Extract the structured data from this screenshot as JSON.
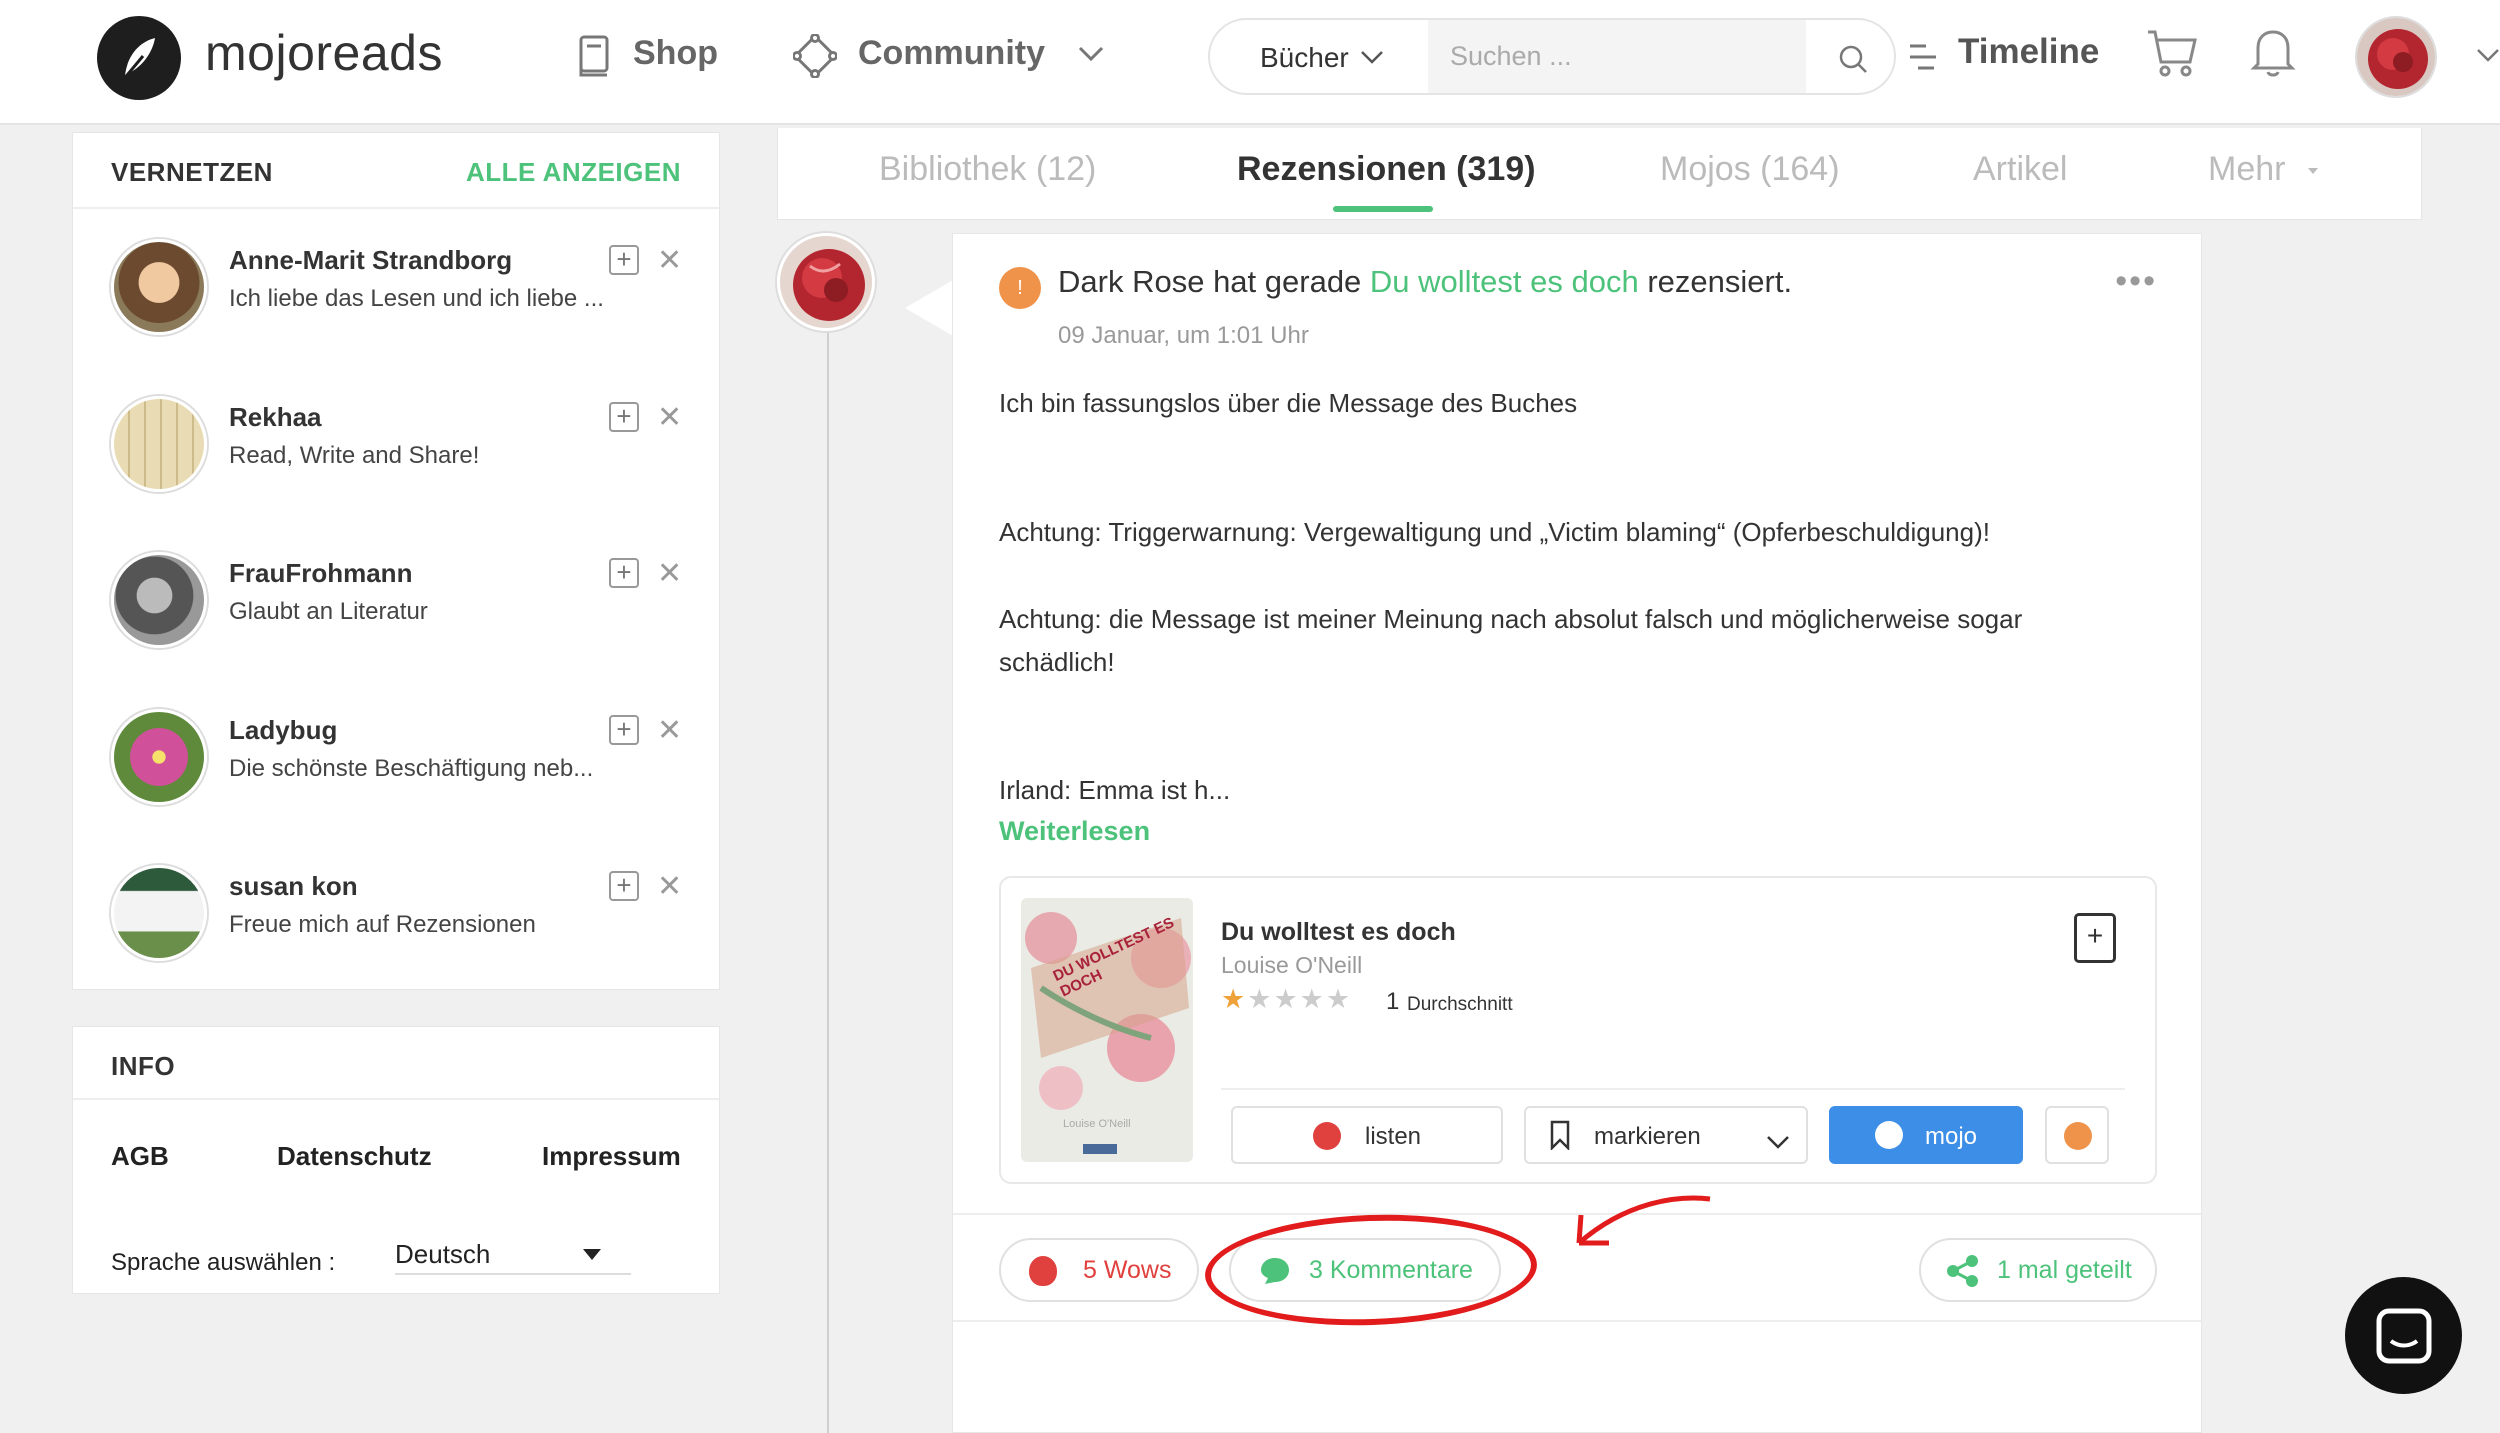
{
  "header": {
    "logo": "mojoreads",
    "nav": {
      "shop": "Shop",
      "community": "Community"
    },
    "search": {
      "category": "Bücher",
      "placeholder": "Suchen ..."
    },
    "timeline": "Timeline"
  },
  "network": {
    "title": "VERNETZEN",
    "show_all": "ALLE ANZEIGEN",
    "people": [
      {
        "name": "Anne-Marit Strandborg",
        "subtitle": "Ich liebe das Lesen und ich liebe ..."
      },
      {
        "name": "Rekhaa",
        "subtitle": "Read, Write and Share!"
      },
      {
        "name": "FrauFrohmann",
        "subtitle": "Glaubt an Literatur"
      },
      {
        "name": "Ladybug",
        "subtitle": "Die schönste Beschäftigung neb..."
      },
      {
        "name": "susan kon",
        "subtitle": "Freue mich auf Rezensionen"
      }
    ]
  },
  "info": {
    "title": "INFO",
    "links": [
      "AGB",
      "Datenschutz",
      "Impressum"
    ],
    "language_label": "Sprache auswählen :",
    "language_value": "Deutsch"
  },
  "tabs": [
    {
      "label": "Bibliothek (12)"
    },
    {
      "label": "Rezensionen (319)"
    },
    {
      "label": "Mojos (164)"
    },
    {
      "label": "Artikel"
    },
    {
      "label": "Mehr"
    }
  ],
  "post": {
    "author": "Dark Rose",
    "action": "hat gerade",
    "book_link": "Du wolltest es doch",
    "action_end": "rezensiert.",
    "date": "09 Januar, um 1:01 Uhr",
    "paragraphs": [
      "Ich bin fassungslos über die Message des Buches",
      "Achtung: Triggerwarnung: Vergewaltigung und „Victim blaming“ (Opferbeschuldigung)!",
      "Achtung: die Message ist meiner Meinung nach absolut falsch und möglicherweise sogar schädlich!",
      "Irland: Emma ist h..."
    ],
    "read_more": "Weiterlesen",
    "book": {
      "title": "Du wolltest es doch",
      "author": "Louise O'Neill",
      "cover_title": "DU WOLLTEST ES DOCH",
      "cover_author": "Louise O'Neill",
      "rating": 1,
      "rating_count": "1",
      "rating_label": "Durchschnitt",
      "btn_list": "listen",
      "btn_mark": "markieren",
      "btn_mojo": "mojo"
    },
    "wows": "5 Wows",
    "comments": "3 Kommentare",
    "shares": "1 mal geteilt"
  },
  "colors": {
    "accent": "#4cc27a",
    "mojo_blue": "#3d8ee6",
    "wow_red": "#e0413e",
    "annotation": "#e21c1c"
  }
}
